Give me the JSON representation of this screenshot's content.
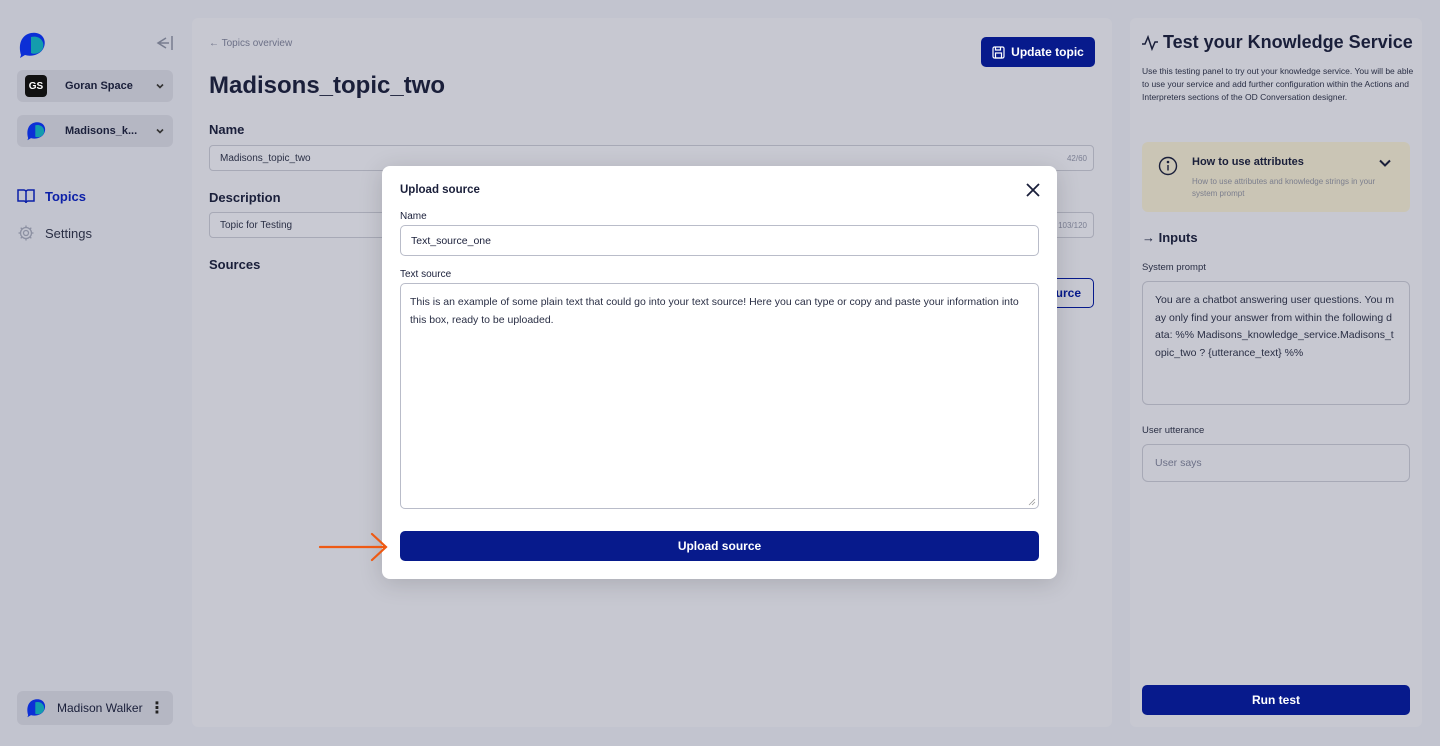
{
  "sidebar": {
    "workspace": {
      "badge": "GS",
      "label": "Goran Space"
    },
    "service": {
      "label": "Madisons_k..."
    },
    "nav": [
      {
        "label": "Topics",
        "icon": "book-icon"
      },
      {
        "label": "Settings",
        "icon": "gear-icon"
      }
    ],
    "user": {
      "name": "Madison Walker"
    }
  },
  "main": {
    "back_link": "← Topics overview",
    "update_button": "Update topic",
    "title": "Madisons_topic_two",
    "name_label": "Name",
    "name_value": "Madisons_topic_two",
    "name_counter": "42/60",
    "description_label": "Description",
    "description_value": "Topic for Testing",
    "description_counter": "103/120",
    "sources_label": "Sources",
    "add_source_button": "urce"
  },
  "test_panel": {
    "title": "Test your Knowledge Service",
    "description": "Use this testing panel to try out your knowledge service. You will be able to use your service and add further configuration within the Actions and Interpreters sections of the OD Conversation designer.",
    "attributes_title": "How to use attributes",
    "attributes_subtitle": "How to use attributes and knowledge strings in your system prompt",
    "inputs_heading": "→ Inputs",
    "system_prompt_label": "System prompt",
    "system_prompt_value": "You are a chatbot answering user questions. You may only find your answer from within the following data: %% Madisons_knowledge_service.Madisons_topic_two ? {utterance_text} %%",
    "user_utterance_label": "User utterance",
    "user_utterance_placeholder": "User says",
    "run_button": "Run test"
  },
  "modal": {
    "title": "Upload source",
    "name_label": "Name",
    "name_value": "Text_source_one",
    "text_label": "Text source",
    "text_value": "This is an example of some plain text that could go into your text source! Here you can type or copy and paste your information into this box, ready to be uploaded.",
    "upload_button": "Upload source"
  },
  "colors": {
    "primary": "#071a8c",
    "overlay_bg": "#c2c4cf",
    "attr_box": "#cac5b5",
    "annotation_arrow": "#ee5a14"
  }
}
